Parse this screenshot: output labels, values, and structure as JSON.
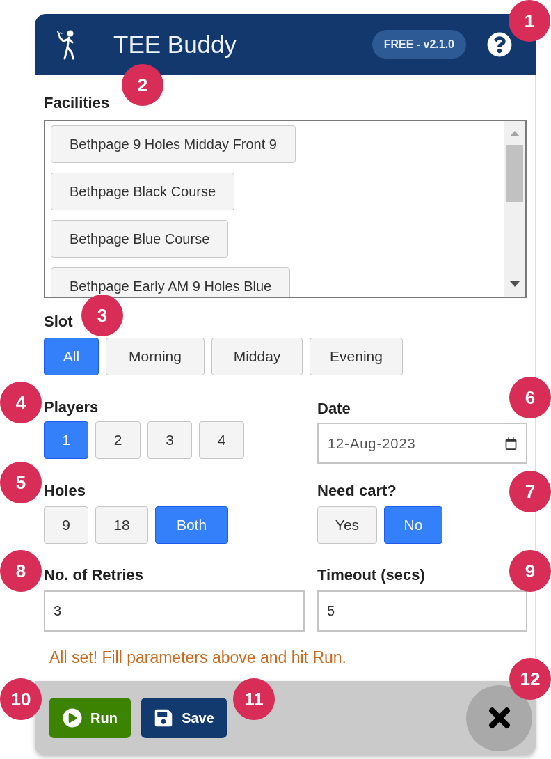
{
  "header": {
    "title": "TEE Buddy",
    "badge": "FREE - v2.1.0"
  },
  "facilities": {
    "label": "Facilities",
    "items": [
      {
        "name": "Bethpage 9 Holes Midday Front 9",
        "selected": false
      },
      {
        "name": "Bethpage Black Course",
        "selected": false
      },
      {
        "name": "Bethpage Blue Course",
        "selected": false
      },
      {
        "name": "Bethpage Early AM 9 Holes Blue",
        "selected": false
      }
    ]
  },
  "slot": {
    "label": "Slot",
    "options": [
      {
        "label": "All",
        "selected": true
      },
      {
        "label": "Morning",
        "selected": false
      },
      {
        "label": "Midday",
        "selected": false
      },
      {
        "label": "Evening",
        "selected": false
      }
    ]
  },
  "players": {
    "label": "Players",
    "options": [
      {
        "label": "1",
        "selected": true
      },
      {
        "label": "2",
        "selected": false
      },
      {
        "label": "3",
        "selected": false
      },
      {
        "label": "4",
        "selected": false
      }
    ]
  },
  "date": {
    "label": "Date",
    "value": "12-Aug-2023"
  },
  "holes": {
    "label": "Holes",
    "options": [
      {
        "label": "9",
        "selected": false
      },
      {
        "label": "18",
        "selected": false
      },
      {
        "label": "Both",
        "selected": true
      }
    ]
  },
  "cart": {
    "label": "Need cart?",
    "options": [
      {
        "label": "Yes",
        "selected": false
      },
      {
        "label": "No",
        "selected": true
      }
    ]
  },
  "retries": {
    "label": "No. of Retries",
    "value": "3"
  },
  "timeout": {
    "label": "Timeout (secs)",
    "value": "5"
  },
  "status_message": "All set! Fill parameters above and hit Run.",
  "footer": {
    "buttons": [
      {
        "kind": "run",
        "label": "Run"
      },
      {
        "kind": "save",
        "label": "Save"
      }
    ]
  },
  "callouts": [
    "1",
    "2",
    "3",
    "4",
    "5",
    "6",
    "7",
    "8",
    "9",
    "10",
    "11",
    "12"
  ]
}
